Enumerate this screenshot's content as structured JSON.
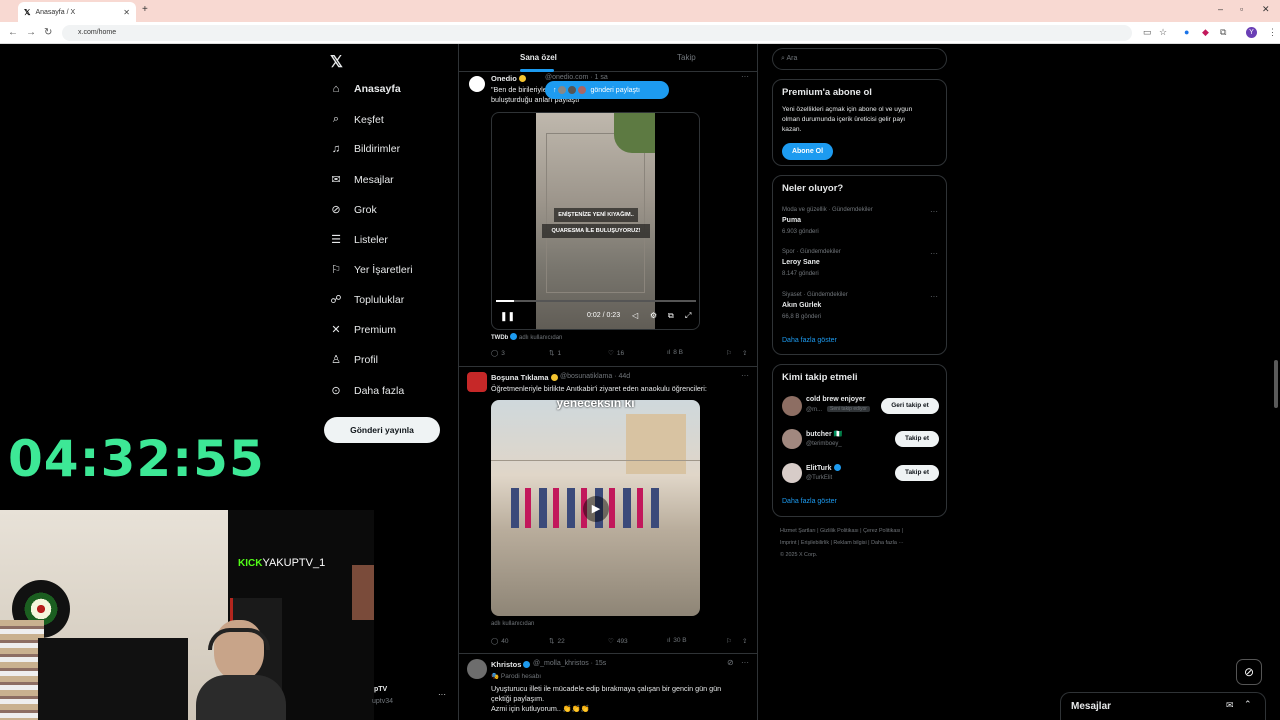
{
  "browser": {
    "tab_title": "Anasayfa / X",
    "url": "x.com/home",
    "profile_initial": "Y"
  },
  "sidebar": {
    "items": [
      {
        "label": "Anasayfa",
        "icon": "home-icon"
      },
      {
        "label": "Keşfet",
        "icon": "search-icon"
      },
      {
        "label": "Bildirimler",
        "icon": "bell-icon"
      },
      {
        "label": "Mesajlar",
        "icon": "mail-icon"
      },
      {
        "label": "Grok",
        "icon": "grok-icon"
      },
      {
        "label": "Listeler",
        "icon": "list-icon"
      },
      {
        "label": "Yer İşaretleri",
        "icon": "bookmark-icon"
      },
      {
        "label": "Topluluklar",
        "icon": "people-icon"
      },
      {
        "label": "Premium",
        "icon": "x-icon"
      },
      {
        "label": "Profil",
        "icon": "person-icon"
      },
      {
        "label": "Daha fazla",
        "icon": "more-circle-icon"
      }
    ],
    "post_button": "Gönderi yayınla",
    "account_name": "pTV",
    "account_handle": "uptv34"
  },
  "feed": {
    "tabs": [
      "Sana özel",
      "Takip"
    ],
    "new_posts_pill": "gönderi paylaştı",
    "tweets": [
      {
        "name": "Onedio",
        "handle": "@onedio.com · 1 sa",
        "text_line1": "\"Ben de birileriyle buluşuyorum\" · Ricardo Quaresma ile",
        "text_line2": "buluşturduğu anları paylaştı",
        "video_caption1": "ENİŞTENİZE YENİ KIYAĞIM..",
        "video_caption2": "QUARESMA İLE BULUŞUYORUZ!",
        "video_time": "0:02 / 0:23",
        "source": "TWDb",
        "source_suffix": "adlı kullanıcıdan",
        "replies": "3",
        "reposts": "1",
        "likes": "16",
        "views": "8 B"
      },
      {
        "name": "Boşuna Tıklama",
        "handle": "@bosunatiklama · 44d",
        "text_line1": "Öğretmenleriyle birlikte Anıtkabir'i ziyaret eden anaokulu öğrencileri:",
        "media_caption": "yeneceksin ki",
        "source_suffix": "adlı kullanıcıdan",
        "replies": "40",
        "reposts": "22",
        "likes": "493",
        "views": "30 B"
      },
      {
        "name": "Khristos",
        "handle": "@_molla_khristos · 15s",
        "parody_label": "Parodi hesabı",
        "text_line1": "Uyuşturucu illeti ile mücadele edip bırakmaya çalışan bir gencin gün gün",
        "text_line2": "çektiği paylaşım.",
        "text_line3": "Azmi için kutluyorum.. 👏👏👏"
      }
    ]
  },
  "right": {
    "search_placeholder": "Ara",
    "premium": {
      "title": "Premium'a abone ol",
      "desc_line1": "Yeni özellikleri açmak için abone ol ve uygun",
      "desc_line2": "olman durumunda içerik üreticisi gelir payı",
      "desc_line3": "kazan.",
      "button": "Abone Ol"
    },
    "trends": {
      "title": "Neler oluyor?",
      "items": [
        {
          "category": "Moda ve güzellik · Gündemdekiler",
          "name": "Puma",
          "count": "6.903 gönderi"
        },
        {
          "category": "Spor · Gündemdekiler",
          "name": "Leroy Sane",
          "count": "8.147 gönderi"
        },
        {
          "category": "Siyaset · Gündemdekiler",
          "name": "Akın Gürlek",
          "count": "66,8 B gönderi"
        }
      ],
      "show_more": "Daha fazla göster"
    },
    "who_to_follow": {
      "title": "Kimi takip etmeli",
      "users": [
        {
          "name": "cold brew enjoyer",
          "handle": "@m...",
          "badge": "Seni takip ediyor",
          "button": "Geri takip et"
        },
        {
          "name": "butcher 🇳🇬",
          "handle": "@terimboey_",
          "button": "Takip et"
        },
        {
          "name": "ElitTurk",
          "handle": "@TurkElit",
          "button": "Takip et"
        }
      ],
      "show_more": "Daha fazla göster"
    },
    "footer_line1": "Hizmet Şartları  |  Gizlilik Politikası  |  Çerez Politikası  |",
    "footer_line2": "Imprint  |  Erişilebilirlik  |  Reklam bilgisi  |  Daha fazla ···",
    "footer_line3": "© 2025 X Corp."
  },
  "overlay": {
    "timer": "04:32:55",
    "kick_brand": "KICK",
    "kick_user": "YAKUPTV_1"
  },
  "messages_bar": {
    "label": "Mesajlar"
  },
  "colors": {
    "accent": "#1d9bf0",
    "timer": "#3de896",
    "kick": "#53fc18"
  }
}
